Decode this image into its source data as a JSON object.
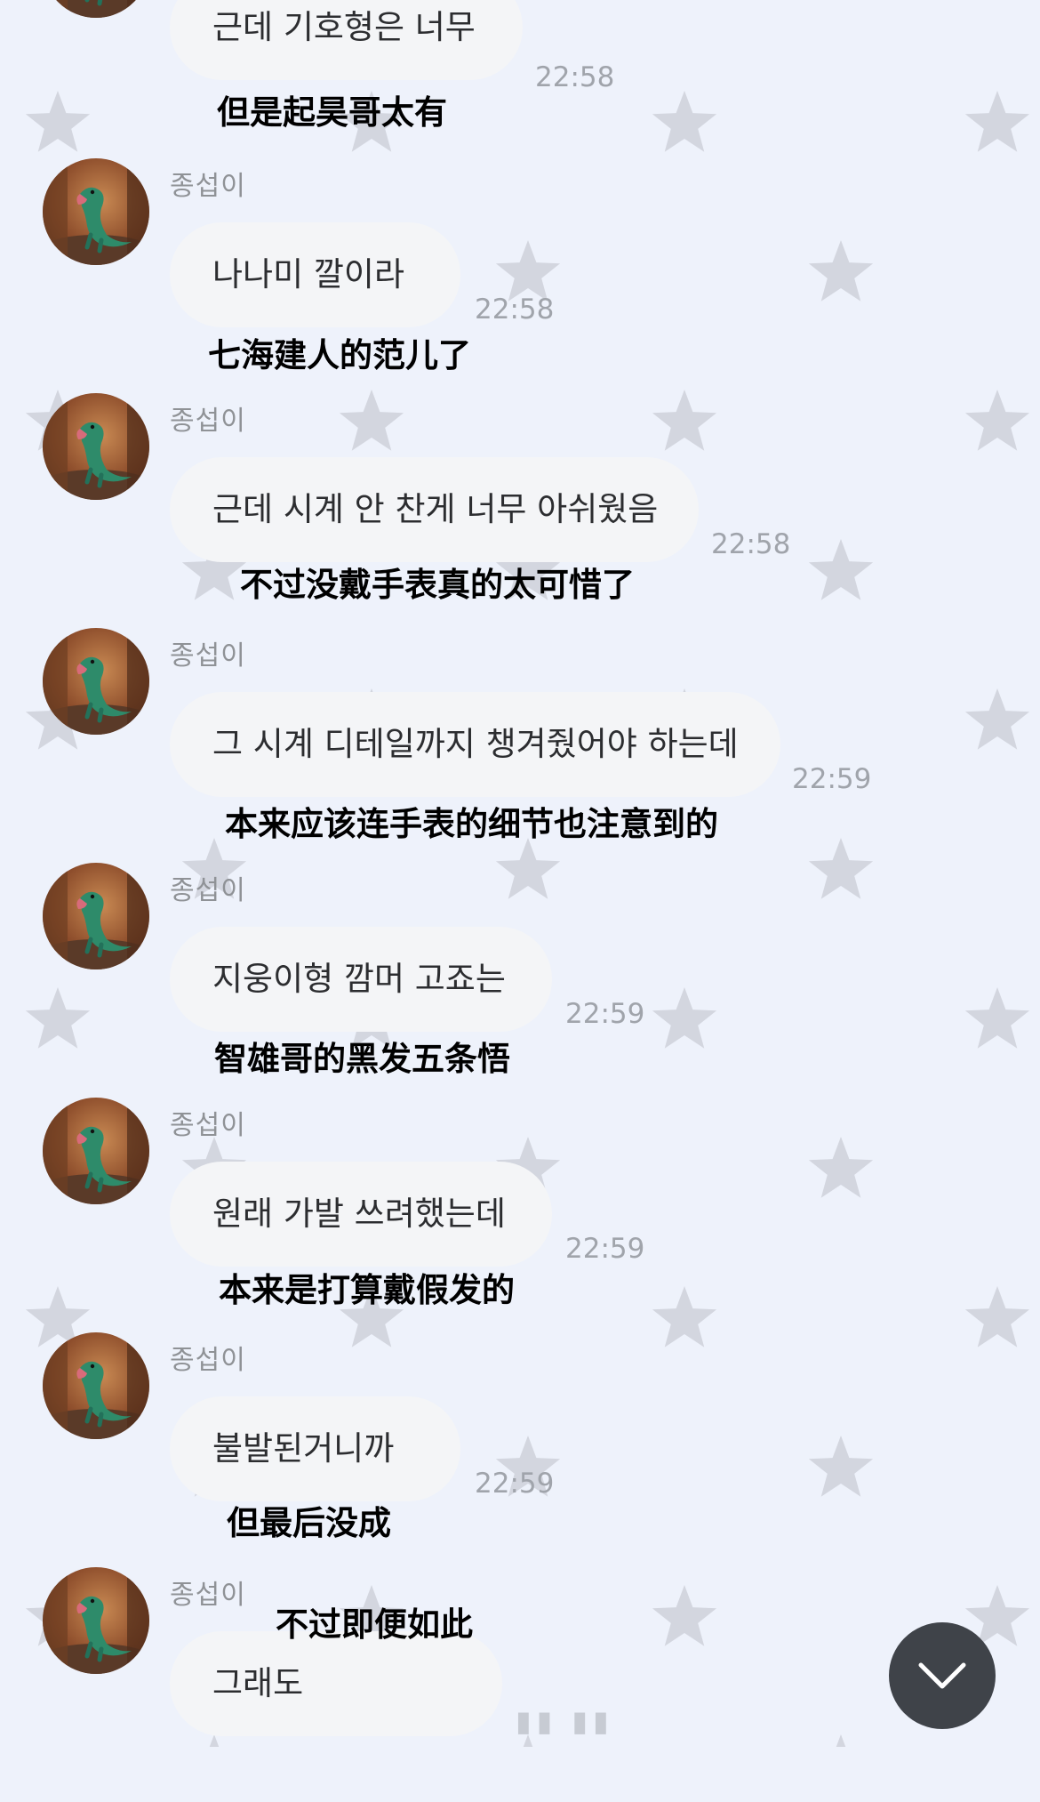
{
  "colors": {
    "background": "#eef2fb",
    "star": "#d3d6df",
    "bubble": "#f4f5f7",
    "sender_text": "#8f9296",
    "timestamp_text": "#a0a4ab",
    "scroll_button": "#3f4349"
  },
  "first_message": {
    "text": "근데 기호형은 너무",
    "time": "22:58",
    "translation": "但是起昊哥太有"
  },
  "messages": [
    {
      "sender": "종섭이",
      "text": "나나미 깔이라",
      "time": "22:58",
      "translation": "七海建人的范儿了"
    },
    {
      "sender": "종섭이",
      "text": "근데 시계 안 찬게 너무 아쉬웠음",
      "time": "22:58",
      "translation": "不过没戴手表真的太可惜了"
    },
    {
      "sender": "종섭이",
      "text": "그 시계 디테일까지 챙겨줬어야 하는데",
      "time": "22:59",
      "translation": "本来应该连手表的细节也注意到的"
    },
    {
      "sender": "종섭이",
      "text": "지웅이형 깜머 고죠는",
      "time": "22:59",
      "translation": "智雄哥的黑发五条悟"
    },
    {
      "sender": "종섭이",
      "text": "원래 가발 쓰려했는데",
      "time": "22:59",
      "translation": "本来是打算戴假发的"
    },
    {
      "sender": "종섭이",
      "text": "불발된거니까",
      "time": "22:59",
      "translation": "但最后没成"
    },
    {
      "sender": "종섭이",
      "text": "그래도",
      "time": "",
      "translation": "不过即便如此"
    }
  ],
  "typing_indicator": "▮▮ ▮▮",
  "scroll_button_icon": "chevron-down-icon",
  "avatar_icon": "dinosaur-avatar-icon"
}
